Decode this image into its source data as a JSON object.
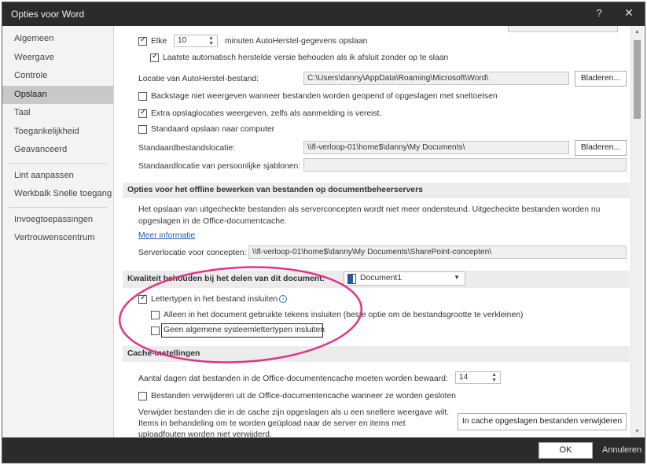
{
  "window": {
    "title": "Opties voor Word",
    "help": "?",
    "close": "✕"
  },
  "sidebar": {
    "items": [
      {
        "label": "Algemeen"
      },
      {
        "label": "Weergave"
      },
      {
        "label": "Controle"
      },
      {
        "label": "Opslaan"
      },
      {
        "label": "Taal"
      },
      {
        "label": "Toegankelijkheid"
      },
      {
        "label": "Geavanceerd"
      },
      {
        "label": "Lint aanpassen"
      },
      {
        "label": "Werkbalk Snelle toegang"
      },
      {
        "label": "Invoegtoepassingen"
      },
      {
        "label": "Vertrouwenscentrum"
      }
    ],
    "active_index": 3
  },
  "save": {
    "elke_label": "Elke",
    "elke_minutes": "10",
    "autoherstel_label": "minuten AutoHerstel-gegevens opslaan",
    "keep_last_label": "Laatste automatisch herstelde versie behouden als ik afsluit zonder op te slaan",
    "autoherstel_location_label": "Locatie van AutoHerstel-bestand:",
    "autoherstel_location_value": "C:\\Users\\danny\\AppData\\Roaming\\Microsoft\\Word\\",
    "browse_label": "Bladeren...",
    "backstage_label": "Backstage niet weergeven wanneer bestanden worden geopend of opgeslagen met sneltoetsen",
    "extra_locations_label": "Extra opslaglocaties weergeven, zelfs als aanmelding is vereist.",
    "default_computer_label": "Standaard opslaan naar computer",
    "default_location_label": "Standaardbestandslocatie:",
    "default_location_value": "\\\\fl-verloop-01\\home$\\danny\\My Documents\\",
    "templates_location_label": "Standaardlocatie van persoonlijke sjablonen:",
    "templates_location_value": ""
  },
  "offline": {
    "header": "Opties voor het offline bewerken van bestanden op documentbeheerservers",
    "description_line1": "Het opslaan van uitgecheckte bestanden als serverconcepten wordt niet meer ondersteund. Uitgecheckte bestanden worden nu",
    "description_line2": "opgeslagen in de Office-documentcache.",
    "more_info": "Meer informatie",
    "server_location_label": "Serverlocatie voor concepten:",
    "server_location_value": "\\\\fl-verloop-01\\home$\\danny\\My Documents\\SharePoint-concepten\\"
  },
  "fidelity": {
    "header": "Kwaliteit behouden bij het delen van dit document:",
    "document_value": "Document1",
    "embed_fonts_label": "Lettertypen in het bestand insluiten",
    "info_glyph": "i",
    "only_used_label": "Alleen in het document gebruikte tekens insluiten (beste optie om de bestandsgrootte te verkleinen)",
    "no_system_fonts_label": "Geen algemene systeemlettertypen insluiten"
  },
  "cache": {
    "header": "Cache-instellingen",
    "days_label": "Aantal dagen dat bestanden in de Office-documentencache moeten worden bewaard:",
    "days_value": "14",
    "delete_on_close_label": "Bestanden verwijderen uit de Office-documentencache wanneer ze worden gesloten",
    "delete_desc_line1": "Verwijder bestanden die in de cache zijn opgeslagen als u een snellere weergave wilt.",
    "delete_desc_line2": "Items in behandeling om te worden geüpload naar de server en items met",
    "delete_desc_line3": "uploadfouten worden niet verwijderd.",
    "delete_button": "In cache opgeslagen bestanden verwijderen"
  },
  "footer": {
    "ok": "OK",
    "cancel": "Annuleren"
  },
  "colors": {
    "annotation": "#e0348a",
    "titlebar": "#2b2b2b",
    "link": "#1b5eac"
  }
}
